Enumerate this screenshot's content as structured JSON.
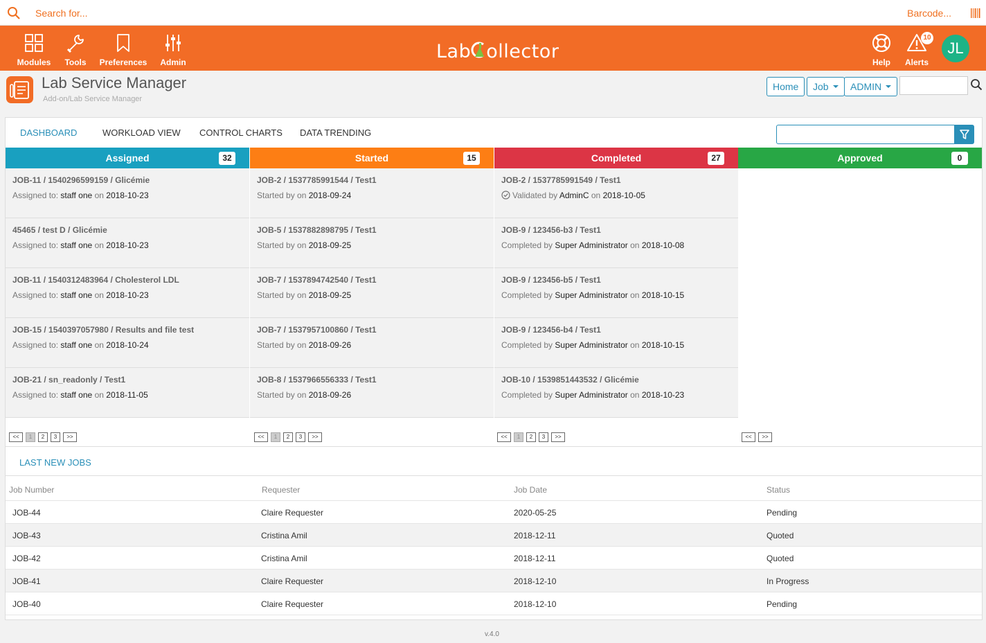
{
  "search": {
    "placeholder": "Search for...",
    "barcode_label": "Barcode..."
  },
  "nav": {
    "items": [
      {
        "label": "Modules",
        "icon": "grid-icon"
      },
      {
        "label": "Tools",
        "icon": "wrench-icon"
      },
      {
        "label": "Preferences",
        "icon": "bookmark-icon"
      },
      {
        "label": "Admin",
        "icon": "sliders-icon"
      }
    ],
    "logo": {
      "part1": "Lab",
      "part2": "ollector"
    },
    "help_label": "Help",
    "alerts_label": "Alerts",
    "alerts_count": "10",
    "avatar_initials": "JL"
  },
  "colors": {
    "brand": "#f26c26",
    "accent": "#2a8fb8",
    "assigned": "#19a0c0",
    "started": "#fd7e14",
    "completed": "#dc3545",
    "approved": "#28a745",
    "avatar": "#1db386"
  },
  "page": {
    "title": "Lab Service Manager",
    "breadcrumb": "Add-on/Lab Service Manager",
    "home_btn": "Home",
    "job_btn": "Job",
    "admin_btn": "ADMIN"
  },
  "tabs": [
    {
      "label": "DASHBOARD"
    },
    {
      "label": "WORKLOAD VIEW"
    },
    {
      "label": "CONTROL CHARTS"
    },
    {
      "label": "DATA TRENDING"
    }
  ],
  "columns": [
    {
      "name": "Assigned",
      "count": "32",
      "cards": [
        {
          "title": "JOB-11 / 1540296599159 / Glicémie",
          "prefix": "Assigned to:",
          "person": "staff one",
          "on": "on",
          "date": "2018-10-23"
        },
        {
          "title": "45465 / test D / Glicémie",
          "prefix": "Assigned to:",
          "person": "staff one",
          "on": "on",
          "date": "2018-10-23"
        },
        {
          "title": "JOB-11 / 1540312483964 / Cholesterol LDL",
          "prefix": "Assigned to:",
          "person": "staff one",
          "on": "on",
          "date": "2018-10-23"
        },
        {
          "title": "JOB-15 / 1540397057980 / Results and file test",
          "prefix": "Assigned to:",
          "person": "staff one",
          "on": "on",
          "date": "2018-10-24"
        },
        {
          "title": "JOB-21 / sn_readonly / Test1",
          "prefix": "Assigned to:",
          "person": "staff one",
          "on": "on",
          "date": "2018-11-05"
        }
      ],
      "pages": [
        "<<",
        "1",
        "2",
        "3",
        ">>"
      ]
    },
    {
      "name": "Started",
      "count": "15",
      "cards": [
        {
          "title": "JOB-2 / 1537785991544 / Test1",
          "prefix": "Started by",
          "person": "",
          "on": "on",
          "date": "2018-09-24"
        },
        {
          "title": "JOB-5 / 1537882898795 / Test1",
          "prefix": "Started by",
          "person": "",
          "on": "on",
          "date": "2018-09-25"
        },
        {
          "title": "JOB-7 / 1537894742540 / Test1",
          "prefix": "Started by",
          "person": "",
          "on": "on",
          "date": "2018-09-25"
        },
        {
          "title": "JOB-7 / 1537957100860 / Test1",
          "prefix": "Started by",
          "person": "",
          "on": "on",
          "date": "2018-09-26"
        },
        {
          "title": "JOB-8 / 1537966556333 / Test1",
          "prefix": "Started by",
          "person": "",
          "on": "on",
          "date": "2018-09-26"
        }
      ],
      "pages": [
        "<<",
        "1",
        "2",
        "3",
        ">>"
      ]
    },
    {
      "name": "Completed",
      "count": "27",
      "cards": [
        {
          "title": "JOB-2 / 1537785991549 / Test1",
          "prefix": "Validated by",
          "person": "AdminC",
          "on": "on",
          "date": "2018-10-05",
          "validated": true
        },
        {
          "title": "JOB-9 / 123456-b3 / Test1",
          "prefix": "Completed by",
          "person": "Super Administrator",
          "on": "on",
          "date": "2018-10-08"
        },
        {
          "title": "JOB-9 / 123456-b5 / Test1",
          "prefix": "Completed by",
          "person": "Super Administrator",
          "on": "on",
          "date": "2018-10-15"
        },
        {
          "title": "JOB-9 / 123456-b4 / Test1",
          "prefix": "Completed by",
          "person": "Super Administrator",
          "on": "on",
          "date": "2018-10-15"
        },
        {
          "title": "JOB-10 / 1539851443532 / Glicémie",
          "prefix": "Completed by",
          "person": "Super Administrator",
          "on": "on",
          "date": "2018-10-23"
        }
      ],
      "pages": [
        "<<",
        "1",
        "2",
        "3",
        ">>"
      ]
    },
    {
      "name": "Approved",
      "count": "0",
      "cards": [],
      "pages": [
        "<<",
        ">>"
      ]
    }
  ],
  "last_jobs": {
    "title": "LAST NEW JOBS",
    "headers": [
      "Job Number",
      "Requester",
      "Job Date",
      "Status"
    ],
    "rows": [
      [
        "JOB-44",
        "Claire Requester",
        "2020-05-25",
        "Pending"
      ],
      [
        "JOB-43",
        "Cristina Amil",
        "2018-12-11",
        "Quoted"
      ],
      [
        "JOB-42",
        "Cristina Amil",
        "2018-12-11",
        "Quoted"
      ],
      [
        "JOB-41",
        "Claire Requester",
        "2018-12-10",
        "In Progress"
      ],
      [
        "JOB-40",
        "Claire Requester",
        "2018-12-10",
        "Pending"
      ]
    ]
  },
  "version": "v.4.0"
}
